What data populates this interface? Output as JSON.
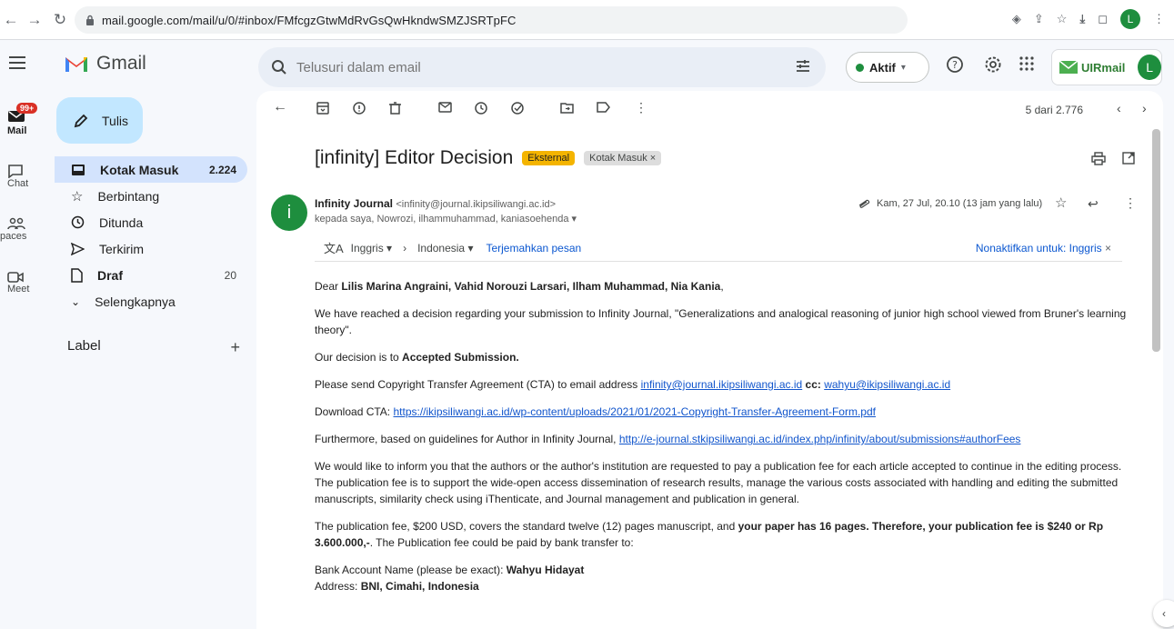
{
  "browser": {
    "url": "mail.google.com/mail/u/0/#inbox/FMfcgzGtwMdRvGsQwHkndwSMZJSRTpFC",
    "profile_initial": "L"
  },
  "header": {
    "app_name": "Gmail",
    "search_placeholder": "Telusuri dalam email",
    "status_label": "Aktif",
    "org_badge": "UIRmail",
    "avatar_initial": "L"
  },
  "rail": {
    "mail_label": "Mail",
    "mail_badge": "99+",
    "chat_label": "Chat",
    "spaces_label": "paces",
    "meet_label": "Meet"
  },
  "sidebar": {
    "compose_label": "Tulis",
    "items": [
      {
        "label": "Kotak Masuk",
        "count": "2.224"
      },
      {
        "label": "Berbintang",
        "count": ""
      },
      {
        "label": "Ditunda",
        "count": ""
      },
      {
        "label": "Terkirim",
        "count": ""
      },
      {
        "label": "Draf",
        "count": "20"
      },
      {
        "label": "Selengkapnya",
        "count": ""
      }
    ],
    "label_heading": "Label",
    "label_add": "+"
  },
  "toolbar": {
    "pager": "5 dari 2.776"
  },
  "email": {
    "subject": "[infinity] Editor Decision",
    "tag_external": "Eksternal",
    "tag_inbox": "Kotak Masuk ×",
    "sender_name": "Infinity Journal",
    "sender_email": "<infinity@journal.ikipsiliwangi.ac.id>",
    "recipients": "kepada saya, Nowrozi, ilhammuhammad, kaniasoehenda ▾",
    "date": "Kam, 27 Jul, 20.10 (13 jam yang lalu)",
    "sender_initial": "i"
  },
  "translate": {
    "from": "Inggris",
    "to": "Indonesia",
    "action": "Terjemahkan pesan",
    "disable": "Nonaktifkan untuk: Inggris"
  },
  "body": {
    "greeting_prefix": "Dear ",
    "greeting_names": "Lilis Marina Angraini, Vahid Norouzi Larsari, Ilham Muhammad, Nia Kania",
    "greeting_suffix": ",",
    "p1": "We have reached a decision regarding your submission to Infinity Journal, \"Generalizations and analogical reasoning of junior high school viewed from Bruner's learning theory\".",
    "p2_prefix": "Our decision is to ",
    "p2_bold": "Accepted Submission.",
    "p3_prefix": "Please send Copyright Transfer Agreement (CTA) to email address ",
    "p3_link1": "infinity@journal.ikipsiliwangi.ac.id",
    "p3_cc": " cc: ",
    "p3_link2": "wahyu@ikipsiliwangi.ac.id",
    "p4_prefix": "Download CTA: ",
    "p4_link": "https://ikipsiliwangi.ac.id/wp-content/uploads/2021/01/2021-Copyright-Transfer-Agreement-Form.pdf",
    "p5_prefix": "Furthermore, based on guidelines for Author in Infinity Journal, ",
    "p5_link": "http://e-journal.stkipsiliwangi.ac.id/index.php/infinity/about/submissions#authorFees",
    "p6": "We would like to inform you that the authors or the author's institution are requested to pay a publication fee for each article accepted to continue in the editing process. The publication fee is to support the wide-open access dissemination of research results, manage the various costs associated with handling and editing the submitted manuscripts, similarity check using iThenticate, and Journal management and publication in general.",
    "p7_prefix": "The publication fee, $200 USD, covers the standard twelve (12) pages manuscript, and ",
    "p7_bold": "your paper has 16 pages. Therefore, your publication fee is $240 or Rp 3.600.000,-",
    "p7_suffix": ". The Publication fee could be paid by bank transfer to:",
    "bank_label": "Bank Account Name (please be exact): ",
    "bank_name": "Wahyu Hidayat",
    "address_label": "Address: ",
    "address_value": "BNI, Cimahi, Indonesia"
  }
}
